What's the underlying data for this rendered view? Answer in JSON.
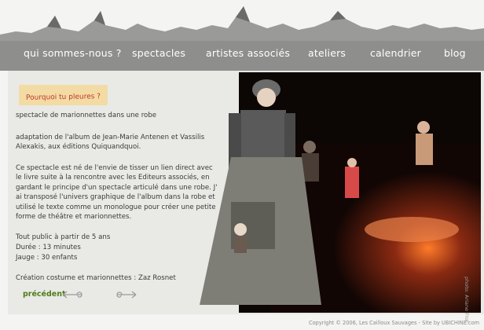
{
  "nav": {
    "items": [
      {
        "label": "qui sommes-nous ?"
      },
      {
        "label": "spectacles"
      },
      {
        "label": "artistes associés"
      },
      {
        "label": "ateliers"
      },
      {
        "label": "calendrier"
      },
      {
        "label": "blog"
      }
    ]
  },
  "content": {
    "tag": "Pourquoi tu pleures ?",
    "subtitle": "spectacle de marionnettes dans une robe",
    "adaptation": "adaptation de l'album de Jean-Marie Antenen et Vassilis Alexakis, aux éditions Quiquandquoi.",
    "description": "Ce spectacle est né de l'envie de tisser un lien direct avec le livre suite à la rencontre avec les Editeurs associés, en gardant le principe d'un spectacle articulé dans une robe. J' ai transposé l'univers graphique de l'album dans la robe et utilisé le texte comme un monologue pour créer une petite forme de théâtre et marionnettes.",
    "audience": "Tout public à partir de 5 ans",
    "duration": "Durée : 13 minutes",
    "capacity": "Jauge : 30 enfants",
    "creation": "Création costume et marionnettes : Zaz Rosnet"
  },
  "pager": {
    "prev_label": "précédent"
  },
  "photo_credit": "photo: Ariane Frot",
  "footer": "Copyright © 2006, Les Cailloux Sauvages - Site by UBICHINE.com",
  "colors": {
    "nav_band": "#8e8e8c",
    "tag_bg": "#f3dba4",
    "tag_text": "#c0392b",
    "prev": "#4f7d1c"
  },
  "icons": [
    "spiral-left-arrow-icon",
    "spiral-right-arrow-icon"
  ]
}
